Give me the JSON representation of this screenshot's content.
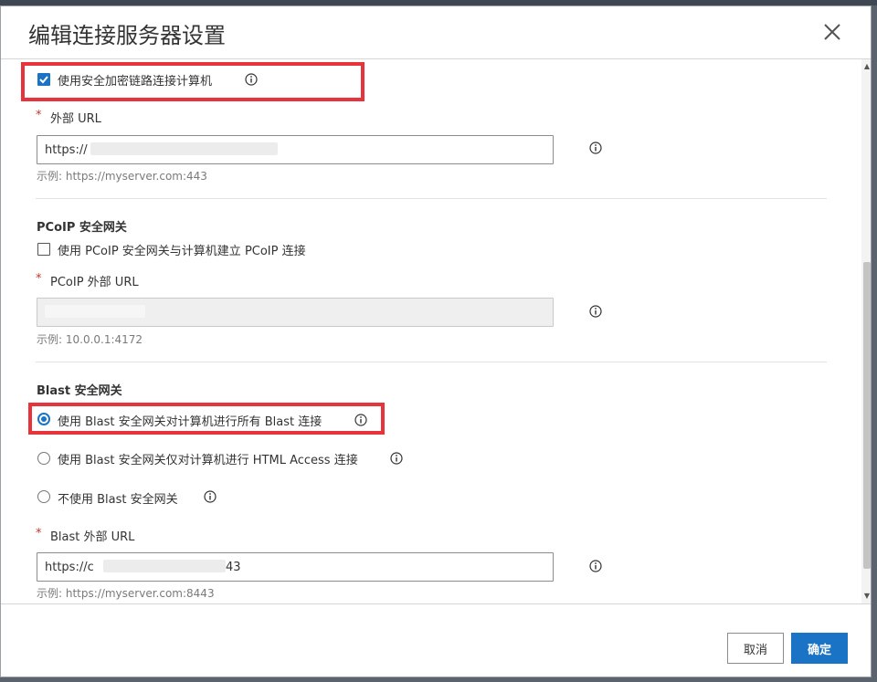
{
  "dialog": {
    "title": "编辑连接服务器设置",
    "close_icon": "close-icon"
  },
  "secure_tunnel": {
    "checkbox_label": "使用安全加密链路连接计算机",
    "checked": true,
    "external_url_label": "外部 URL",
    "external_url_value": "https://",
    "external_url_hint": "示例: https://myserver.com:443"
  },
  "pcoip": {
    "section_title": "PCoIP 安全网关",
    "checkbox_label": "使用 PCoIP 安全网关与计算机建立 PCoIP 连接",
    "checked": false,
    "external_url_label": "PCoIP 外部 URL",
    "external_url_value": "",
    "external_url_hint": "示例: 10.0.0.1:4172"
  },
  "blast": {
    "section_title": "Blast 安全网关",
    "options": [
      {
        "label": "使用 Blast 安全网关对计算机进行所有 Blast 连接",
        "checked": true
      },
      {
        "label": "使用 Blast 安全网关仅对计算机进行 HTML Access 连接",
        "checked": false
      },
      {
        "label": "不使用 Blast 安全网关",
        "checked": false
      }
    ],
    "external_url_label": "Blast 外部 URL",
    "external_url_value": "https://c",
    "external_url_value_tail": "43",
    "external_url_hint": "示例: https://myserver.com:8443"
  },
  "required_mark": "*",
  "footer": {
    "cancel_label": "取消",
    "ok_label": "确定"
  },
  "colors": {
    "accent": "#1a73c5",
    "highlight": "#e8323c",
    "required": "#c0392b"
  }
}
